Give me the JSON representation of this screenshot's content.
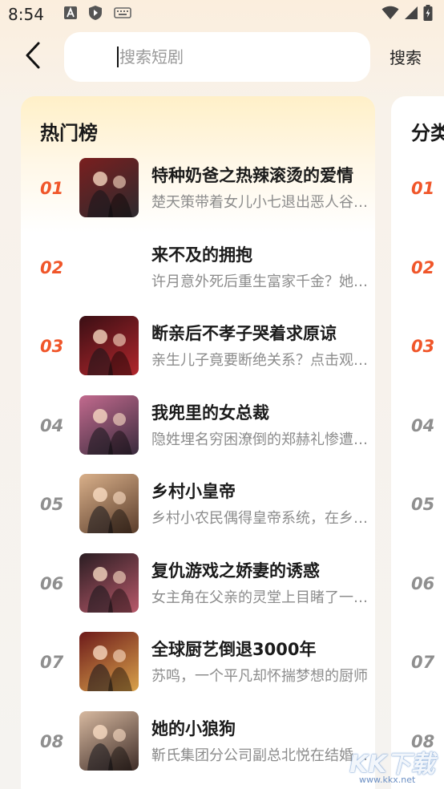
{
  "status_bar": {
    "time": "8:54",
    "left_icons": [
      "font-icon",
      "shield-icon",
      "keyboard-icon"
    ],
    "right_icons": [
      "wifi-icon",
      "signal-icon",
      "battery-charging-icon"
    ]
  },
  "header": {
    "back_icon": "chevron-left-icon",
    "search_placeholder": "搜索短剧",
    "search_value": "",
    "search_button": "搜索"
  },
  "hot_list": {
    "title": "热门榜",
    "items": [
      {
        "rank": "01",
        "title": "特种奶爸之热辣滚烫的爱情",
        "desc": "楚天策带着女儿小七退出恶人谷，准备过平凡生活",
        "hot": true,
        "cover_colors": [
          "#7a1f1f",
          "#2d2a2e"
        ]
      },
      {
        "rank": "02",
        "title": "来不及的拥抱",
        "desc": "许月意外死后重生富家千金？她能否改写命运",
        "hot": true,
        "cover_colors": []
      },
      {
        "rank": "03",
        "title": "断亲后不孝子哭着求原谅",
        "desc": "亲生儿子竟要断绝关系？点击观看完整剧情",
        "hot": true,
        "cover_colors": [
          "#3a0f14",
          "#b1262c"
        ]
      },
      {
        "rank": "04",
        "title": "我兜里的女总裁",
        "desc": "隐姓埋名穷困潦倒的郑赫礼惨遭陷害",
        "hot": false,
        "cover_colors": [
          "#c26a8e",
          "#3a2b3d"
        ]
      },
      {
        "rank": "05",
        "title": "乡村小皇帝",
        "desc": "乡村小农民偶得皇帝系统，在乡村大展身手",
        "hot": false,
        "cover_colors": [
          "#d9b08a",
          "#5b3d2b"
        ]
      },
      {
        "rank": "06",
        "title": "复仇游戏之娇妻的诱惑",
        "desc": "女主角在父亲的灵堂上目睹了一切真相",
        "hot": false,
        "cover_colors": [
          "#2a1d22",
          "#b8596a"
        ]
      },
      {
        "rank": "07",
        "title": "全球厨艺倒退3000年",
        "desc": "苏鸣，一个平凡却怀揣梦想的厨师",
        "hot": false,
        "cover_colors": [
          "#6d1a1a",
          "#d9a24b"
        ]
      },
      {
        "rank": "08",
        "title": "她的小狼狗",
        "desc": "靳氏集团分公司副总北悦在结婚前夕",
        "hot": false,
        "cover_colors": [
          "#d7b9a0",
          "#3f2d28"
        ]
      }
    ]
  },
  "category_list": {
    "title": "分类",
    "items": [
      {
        "rank": "01",
        "hot": true
      },
      {
        "rank": "02",
        "hot": true
      },
      {
        "rank": "03",
        "hot": true
      },
      {
        "rank": "04",
        "hot": false
      },
      {
        "rank": "05",
        "hot": false
      },
      {
        "rank": "06",
        "hot": false
      },
      {
        "rank": "07",
        "hot": false
      },
      {
        "rank": "08",
        "hot": false
      }
    ]
  },
  "watermark": {
    "text": "KK下载",
    "url": "www.kkx.net"
  }
}
